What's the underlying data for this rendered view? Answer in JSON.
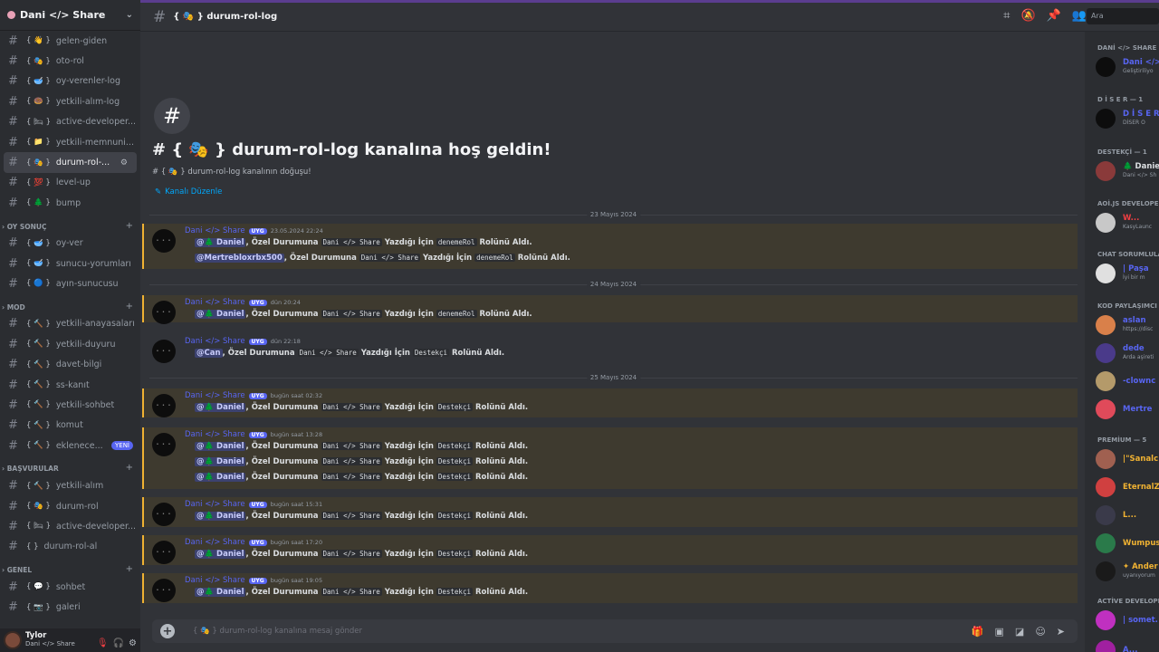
{
  "server": {
    "name": "Dani </> Share"
  },
  "sidebar": {
    "channels_top": [
      {
        "emoji": "{ 👋 }",
        "name": "gelen-giden"
      },
      {
        "emoji": "{ 🎭 }",
        "name": "oto-rol"
      },
      {
        "emoji": "{ 🥣 }",
        "name": "oy-verenler-log"
      },
      {
        "emoji": "{ 🍩 }",
        "name": "yetkili-alım-log"
      },
      {
        "emoji": "{ 🛏 }",
        "name": "active-developer..."
      },
      {
        "emoji": "{ 📁 }",
        "name": "yetkili-memnuni..."
      },
      {
        "emoji": "{ 🎭 }",
        "name": "durum-rol-...",
        "active": true
      },
      {
        "emoji": "{ 💯 }",
        "name": "level-up"
      },
      {
        "emoji": "{ 🌲 }",
        "name": "bump"
      }
    ],
    "categories": [
      {
        "name": "OY SONUÇ",
        "channels": [
          {
            "emoji": "{ 🥣 }",
            "name": "oy-ver"
          },
          {
            "emoji": "{ 🥣 }",
            "name": "sunucu-yorumları"
          },
          {
            "emoji": "{ 🔵 }",
            "name": "ayın-sunucusu"
          }
        ]
      },
      {
        "name": "MOD",
        "channels": [
          {
            "emoji": "{ 🔨 }",
            "name": "yetkili-anayasaları"
          },
          {
            "emoji": "{ 🔨 }",
            "name": "yetkili-duyuru"
          },
          {
            "emoji": "{ 🔨 }",
            "name": "davet-bilgi"
          },
          {
            "emoji": "{ 🔨 }",
            "name": "ss-kanıt"
          },
          {
            "emoji": "{ 🔨 }",
            "name": "yetkili-sohbet"
          },
          {
            "emoji": "{ 🔨 }",
            "name": "komut"
          },
          {
            "emoji": "{ 🔨 }",
            "name": "eklenece...",
            "badge": "YENİ"
          }
        ]
      },
      {
        "name": "BAŞVURULAR",
        "channels": [
          {
            "emoji": "{ 🔨 }",
            "name": "yetkili-alım"
          },
          {
            "emoji": "{ 🎭 }",
            "name": "durum-rol"
          },
          {
            "emoji": "{ 🛏 }",
            "name": "active-developer..."
          },
          {
            "emoji": "{ }",
            "name": "durum-rol-al"
          }
        ]
      },
      {
        "name": "GENEL",
        "channels": [
          {
            "emoji": "{ 💬 }",
            "name": "sohbet"
          },
          {
            "emoji": "{ 📷 }",
            "name": "galeri"
          }
        ]
      }
    ]
  },
  "user": {
    "name": "Tylor",
    "status": "Dani </> Share"
  },
  "header": {
    "channel": "{ 🎭 } durum-rol-log",
    "search_placeholder": "Ara"
  },
  "welcome": {
    "title": "# { 🎭 } durum-rol-log kanalına hoş geldin!",
    "subtitle": "# { 🎭 } durum-rol-log kanalının doğuşu!",
    "edit": "Kanalı Düzenle"
  },
  "dates": [
    "23 Mayıs 2024",
    "24 Mayıs 2024",
    "25 Mayıs 2024"
  ],
  "common": {
    "author": "Dani </> Share",
    "badge": "UYG",
    "ozel": "Özel Durumuna",
    "share": "Dani </> Share",
    "yazdigi": "Yazdığı İçin",
    "alid": "Rolünü Aldı."
  },
  "messages": [
    {
      "time": "23.05.2024 22:24",
      "highlight": true,
      "lines": [
        {
          "mention": "@🌲 Daniel",
          "role": "denemeRol"
        },
        {
          "mention": "@Mertrebloxrbx500",
          "role": "denemeRol"
        }
      ]
    },
    {
      "time": "dün 20:24",
      "highlight": true,
      "lines": [
        {
          "mention": "@🌲 Daniel",
          "role": "denemeRol"
        }
      ]
    },
    {
      "time": "dün 22:18",
      "highlight": false,
      "lines": [
        {
          "mention": "@Can",
          "role": "Destekçi"
        }
      ]
    },
    {
      "time": "bugün saat 02:32",
      "highlight": true,
      "lines": [
        {
          "mention": "@🌲 Daniel",
          "role": "Destekçi"
        }
      ]
    },
    {
      "time": "bugün saat 13:28",
      "highlight": true,
      "lines": [
        {
          "mention": "@🌲 Daniel",
          "role": "Destekçi"
        },
        {
          "mention": "@🌲 Daniel",
          "role": "Destekçi"
        },
        {
          "mention": "@🌲 Daniel",
          "role": "Destekçi"
        }
      ]
    },
    {
      "time": "bugün saat 15:31",
      "highlight": true,
      "lines": [
        {
          "mention": "@🌲 Daniel",
          "role": "Destekçi"
        }
      ]
    },
    {
      "time": "bugün saat 17:20",
      "highlight": true,
      "lines": [
        {
          "mention": "@🌲 Daniel",
          "role": "Destekçi"
        }
      ]
    },
    {
      "time": "bugün saat 19:05",
      "highlight": true,
      "lines": [
        {
          "mention": "@🌲 Daniel",
          "role": "Destekçi"
        }
      ]
    }
  ],
  "input": {
    "placeholder": "{ 🎭 } durum-rol-log kanalına mesaj gönder"
  },
  "members": {
    "groups": [
      {
        "title": "DANİ </> SHARE — 1",
        "members": [
          {
            "name": "Dani </>",
            "status": "Geliştiriliyo",
            "color": "#5865f2",
            "avatar": "#0d0d0d"
          }
        ]
      },
      {
        "title": "D İ S E R — 1",
        "members": [
          {
            "name": "D İ S E R",
            "status": "DİSER O",
            "color": "#5865f2",
            "avatar": "#0d0d0d"
          }
        ]
      },
      {
        "title": "DESTEKÇİ — 1",
        "members": [
          {
            "name": "🌲 Daniel",
            "status": "Dani </> Sh",
            "color": "#dbdee1",
            "avatar": "#8a3a3a"
          }
        ]
      },
      {
        "title": "AOİ.JS DEVELOPER",
        "members": [
          {
            "name": "W...",
            "status": "KasyLaunc",
            "color": "#f23f43",
            "avatar": "#c8c8c8"
          }
        ]
      },
      {
        "title": "CHAT SORUMLULARI",
        "members": [
          {
            "name": "| Paşa",
            "status": "İyi bir m",
            "color": "#5865f2",
            "avatar": "#e0e0e0"
          }
        ]
      },
      {
        "title": "KOD PAYLAŞIMCI",
        "members": [
          {
            "name": "aslan",
            "status": "https://disc",
            "color": "#5865f2",
            "avatar": "#d9804a"
          },
          {
            "name": "dede",
            "status": "Arda aşireti",
            "color": "#5865f2",
            "avatar": "#4a3a8a"
          },
          {
            "name": "-clownc",
            "status": "",
            "color": "#5865f2",
            "avatar": "#b49a6a"
          },
          {
            "name": "Mertre",
            "status": "",
            "color": "#5865f2",
            "avatar": "#e04a5a"
          }
        ]
      },
      {
        "title": "PREMİUM — 5",
        "members": [
          {
            "name": "|\"Sanalc",
            "status": "",
            "color": "#f0b232",
            "avatar": "#a06050"
          },
          {
            "name": "EternalZ",
            "status": "",
            "color": "#f0b232",
            "avatar": "#d04040"
          },
          {
            "name": "L...",
            "status": "",
            "color": "#f0b232",
            "avatar": "#3a3a4a"
          },
          {
            "name": "Wumpus",
            "status": "",
            "color": "#f0b232",
            "avatar": "#2a7a4a"
          },
          {
            "name": "✦ Ander",
            "status": "uyanıyorum",
            "color": "#f0b232",
            "avatar": "#1a1a1a"
          }
        ]
      },
      {
        "title": "ACTİVE DEVELOPE",
        "members": [
          {
            "name": "| somet.",
            "status": "",
            "color": "#5865f2",
            "avatar": "#c030c0"
          },
          {
            "name": "A...",
            "status": "",
            "color": "#5865f2",
            "avatar": "#a020a0"
          }
        ]
      }
    ]
  }
}
